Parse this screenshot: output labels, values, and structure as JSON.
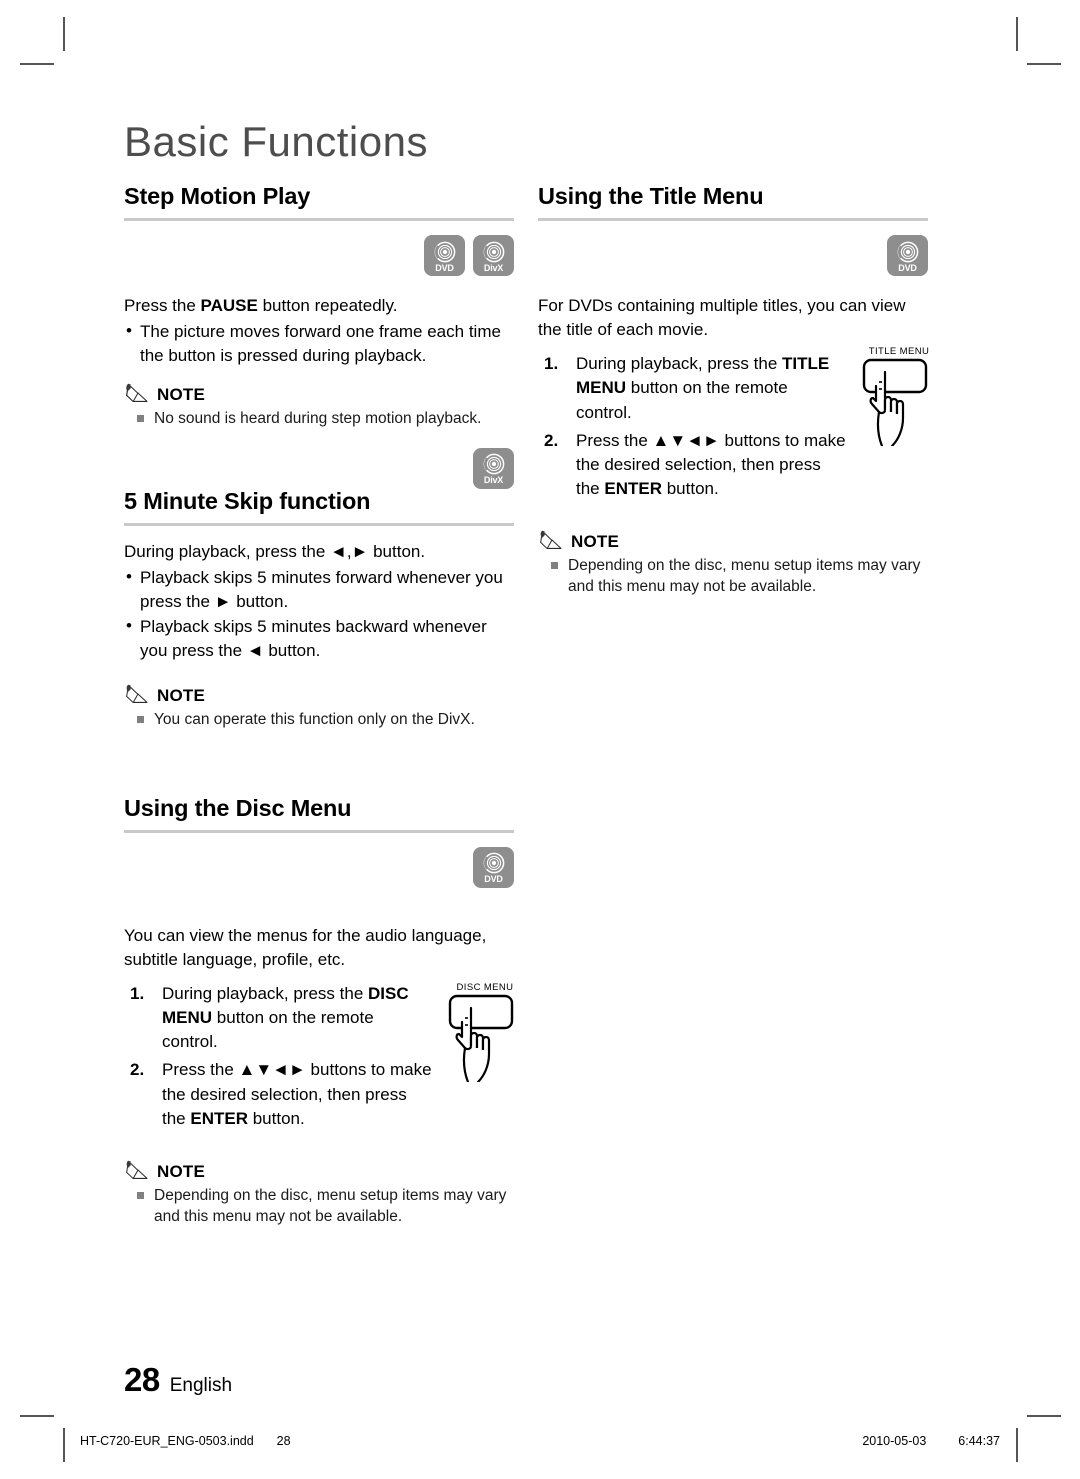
{
  "chapter": {
    "title": "Basic Functions"
  },
  "left_column": {
    "step_motion": {
      "heading": "Step Motion Play",
      "badges": [
        {
          "icon": "disc-icon",
          "label": "DVD"
        },
        {
          "icon": "disc-icon",
          "label": "DivX"
        }
      ],
      "intro_pre": "Press the ",
      "intro_bold": "PAUSE",
      "intro_post": " button repeatedly.",
      "bullets": [
        "The picture moves forward one frame each time the button is pressed during playback."
      ],
      "note": {
        "label": "NOTE",
        "items": [
          "No sound is heard during step motion playback."
        ]
      }
    },
    "skip_function": {
      "heading": "5 Minute Skip function",
      "badges": [
        {
          "icon": "disc-icon",
          "label": "DivX"
        }
      ],
      "intro": "During playback, press the ◄,► button.",
      "bullets": [
        "Playback skips 5 minutes forward whenever you press the ► button.",
        "Playback skips 5 minutes backward whenever you press the ◄ button."
      ],
      "note": {
        "label": "NOTE",
        "items": [
          "You can operate this function only on the DivX."
        ]
      }
    },
    "disc_menu": {
      "heading": "Using the Disc Menu",
      "badges": [
        {
          "icon": "disc-icon",
          "label": "DVD"
        }
      ],
      "intro": "You can view the menus for the audio language, subtitle language, profile, etc.",
      "steps": [
        {
          "pre": "During playback, press the ",
          "bold": "DISC MENU",
          "post": " button on the remote control."
        },
        {
          "pre": "Press the ▲▼◄► buttons to make the desired selection, then press the ",
          "bold": "ENTER",
          "post": " button."
        }
      ],
      "button_figure": {
        "caption": "DISC MENU",
        "icon": "hand-press-button-icon"
      },
      "note": {
        "label": "NOTE",
        "items": [
          "Depending on the disc, menu setup items may vary and this menu may not be available."
        ]
      }
    }
  },
  "right_column": {
    "title_menu": {
      "heading": "Using the Title Menu",
      "badges": [
        {
          "icon": "disc-icon",
          "label": "DVD"
        }
      ],
      "intro": "For DVDs containing multiple titles, you can view the title of each movie.",
      "steps": [
        {
          "pre": "During playback, press the ",
          "bold": "TITLE MENU",
          "post": " button on the remote control."
        },
        {
          "pre": "Press the ▲▼◄► buttons to make the desired selection, then press the ",
          "bold": "ENTER",
          "post": " button."
        }
      ],
      "button_figure": {
        "caption": "TITLE MENU",
        "icon": "hand-press-button-icon"
      },
      "note": {
        "label": "NOTE",
        "items": [
          "Depending on the disc, menu setup items may vary and this menu may not be available."
        ]
      }
    }
  },
  "footer": {
    "page_number": "28",
    "language": "English",
    "file_name": "HT-C720-EUR_ENG-0503.indd",
    "file_page": "28",
    "print_date": "2010-05-03",
    "print_time": "6:44:37"
  },
  "colors": {
    "badge_gray": "#8e8e8e",
    "rule_gray": "#c9c9c9",
    "chapter_title_gray": "#4d4d4d",
    "note_square_gray": "#808080"
  }
}
